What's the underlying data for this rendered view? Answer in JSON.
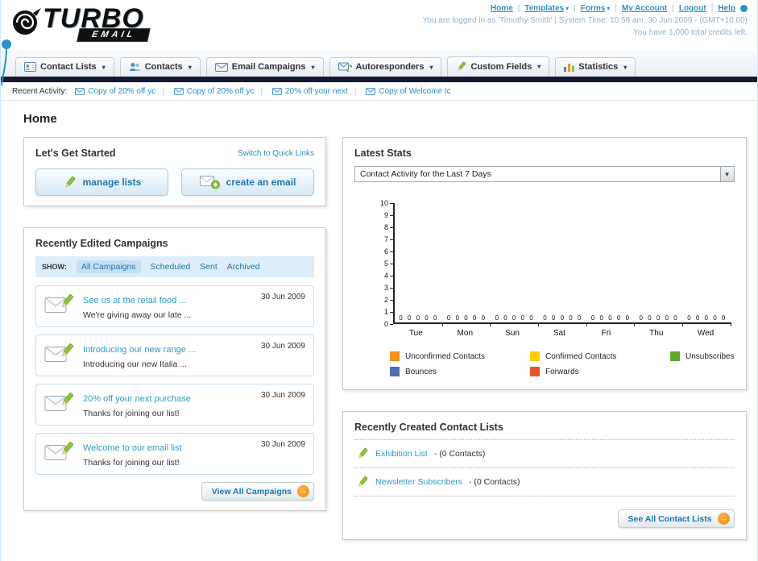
{
  "page_title": "Home",
  "colors": {
    "link_blue": "#2d8fc4",
    "accent_orange": "#f7941d",
    "nav_bar_dark": "#141831"
  },
  "header": {
    "logo_title": "TURBO",
    "logo_subtitle": "EMAIL",
    "top_links": [
      {
        "label": "Home"
      },
      {
        "label": "Templates"
      },
      {
        "label": "Forms"
      },
      {
        "label": "My Account"
      },
      {
        "label": "Logout"
      },
      {
        "label": "Help"
      }
    ],
    "login_info": "You are logged in as 'Timothy Smith' | System Time: 10:58 am, 30 Jun 2009 - (GMT+10:00)",
    "credits_info": "You have 1,000 total credits left."
  },
  "nav_tabs": [
    {
      "label": "Contact Lists",
      "icon": "contact-lists-icon"
    },
    {
      "label": "Contacts",
      "icon": "contacts-icon"
    },
    {
      "label": "Email Campaigns",
      "icon": "email-campaigns-icon"
    },
    {
      "label": "Autoresponders",
      "icon": "autoresponders-icon"
    },
    {
      "label": "Custom Fields",
      "icon": "custom-fields-icon"
    },
    {
      "label": "Statistics",
      "icon": "statistics-icon"
    }
  ],
  "recent_activity": {
    "label": "Recent Activity:",
    "items": [
      {
        "label": "Copy of 20% off yc"
      },
      {
        "label": "Copy of 20% off yc"
      },
      {
        "label": "20% off your next"
      },
      {
        "label": "Copy of Welcome tc"
      }
    ]
  },
  "get_started": {
    "title": "Let's Get Started",
    "switch_link": "Switch to Quick Links",
    "manage_lists_label": "manage lists",
    "create_email_label": "create an email"
  },
  "campaigns": {
    "title": "Recently Edited Campaigns",
    "show_label": "SHOW:",
    "filters": [
      "All Campaigns",
      "Scheduled",
      "Sent",
      "Archived"
    ],
    "items": [
      {
        "title": "See us at the retail food ...",
        "subtitle": "We're giving away our late ...",
        "date": "30 Jun 2009"
      },
      {
        "title": "Introducing our new range ...",
        "subtitle": "Introducing our new Italia ...",
        "date": "30 Jun 2009"
      },
      {
        "title": "20% off your next purchase",
        "subtitle": "Thanks for joining our list!",
        "date": "30 Jun 2009"
      },
      {
        "title": "Welcome to our email list",
        "subtitle": "Thanks for joining our list!",
        "date": "30 Jun 2009"
      }
    ],
    "view_all_label": "View All Campaigns"
  },
  "stats": {
    "title": "Latest Stats",
    "selected_filter": "Contact Activity for the Last 7 Days",
    "chart_data": {
      "type": "bar",
      "title": "Contact Activity for the Last 7 Days",
      "categories": [
        "Tue",
        "Mon",
        "Sun",
        "Sat",
        "Fri",
        "Thu",
        "Wed"
      ],
      "series": [
        {
          "name": "Unconfirmed Contacts",
          "color": "#f7941d",
          "values": [
            0,
            0,
            0,
            0,
            0,
            0,
            0
          ]
        },
        {
          "name": "Confirmed Contacts",
          "color": "#ffcc00",
          "values": [
            0,
            0,
            0,
            0,
            0,
            0,
            0
          ]
        },
        {
          "name": "Unsubscribes",
          "color": "#61a828",
          "values": [
            0,
            0,
            0,
            0,
            0,
            0,
            0
          ]
        },
        {
          "name": "Bounces",
          "color": "#4d6fae",
          "values": [
            0,
            0,
            0,
            0,
            0,
            0,
            0
          ]
        },
        {
          "name": "Forwards",
          "color": "#e8542a",
          "values": [
            0,
            0,
            0,
            0,
            0,
            0,
            0
          ]
        }
      ],
      "ylim": [
        0,
        10
      ],
      "grid": false,
      "legend_position": "bottom"
    }
  },
  "contact_lists": {
    "title": "Recently Created Contact Lists",
    "items": [
      {
        "name": "Exhibition List",
        "detail": "- (0 Contacts)"
      },
      {
        "name": "Newsletter Subscribers",
        "detail": "- (0 Contacts)"
      }
    ],
    "see_all_label": "See All Contact Lists"
  }
}
